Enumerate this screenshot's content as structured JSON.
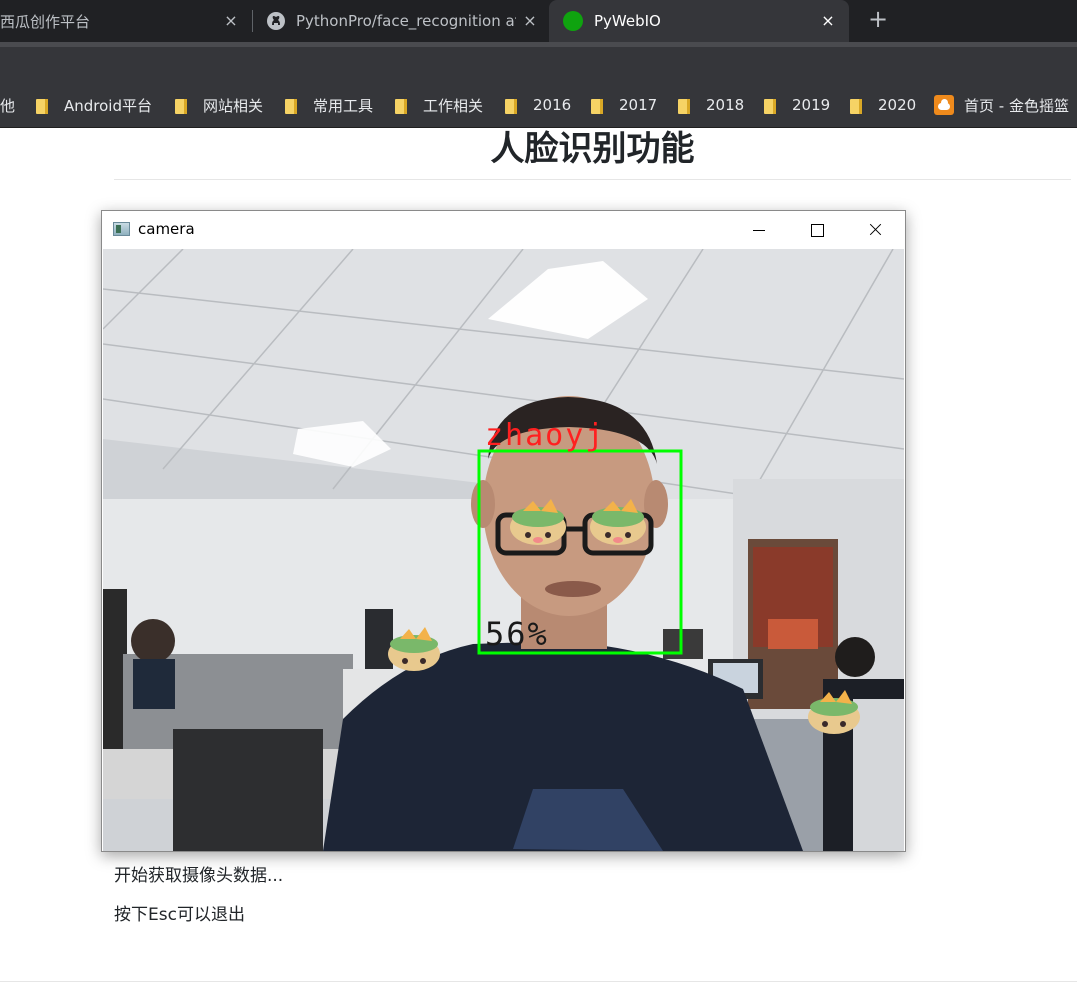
{
  "browser": {
    "tabs": [
      {
        "title": "西瓜创作平台",
        "active": false
      },
      {
        "title": "PythonPro/face_recognition at",
        "active": false
      },
      {
        "title": "PyWebIO",
        "active": true
      }
    ],
    "close_glyph": "×",
    "new_tab_glyph": "+",
    "bookmarks": [
      {
        "label": "他",
        "icon": "none"
      },
      {
        "label": "Android平台",
        "icon": "folder-icon"
      },
      {
        "label": "网站相关",
        "icon": "folder-icon"
      },
      {
        "label": "常用工具",
        "icon": "folder-icon"
      },
      {
        "label": "工作相关",
        "icon": "folder-icon"
      },
      {
        "label": "2016",
        "icon": "folder-icon"
      },
      {
        "label": "2017",
        "icon": "folder-icon"
      },
      {
        "label": "2018",
        "icon": "folder-icon"
      },
      {
        "label": "2019",
        "icon": "folder-icon"
      },
      {
        "label": "2020",
        "icon": "folder-icon"
      },
      {
        "label": "首页 - 金色摇篮",
        "icon": "cloud-site-icon"
      }
    ]
  },
  "page": {
    "title": "人脸识别功能",
    "status_lines": [
      "开始获取摄像头数据...",
      "按下Esc可以退出"
    ]
  },
  "camera_window": {
    "title": "camera",
    "detection": {
      "name_label": "zhaoyj",
      "confidence_label": "56%",
      "box_color": "#00ff00",
      "name_color": "#ff2020"
    }
  },
  "colors": {
    "tabbar_bg": "#202124",
    "toolbar_bg": "#35363a",
    "favicon_pywebio": "#0fa30f"
  }
}
